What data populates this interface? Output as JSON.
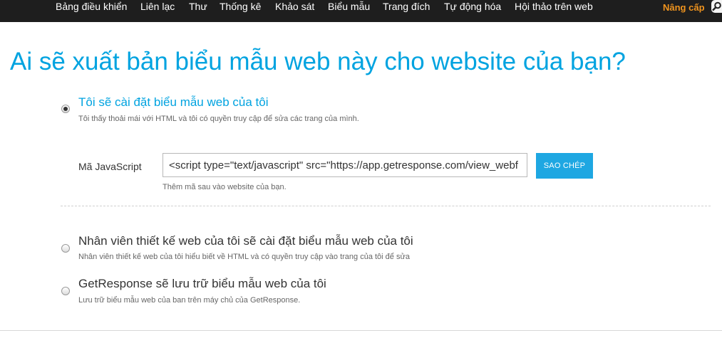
{
  "nav": {
    "items": [
      {
        "label": "Bảng điều khiển"
      },
      {
        "label": "Liên lạc"
      },
      {
        "label": "Thư"
      },
      {
        "label": "Thống kê"
      },
      {
        "label": "Khảo sát"
      },
      {
        "label": "Biểu mẫu"
      },
      {
        "label": "Trang đích"
      },
      {
        "label": "Tự động hóa"
      },
      {
        "label": "Hội thảo trên web"
      }
    ],
    "upgrade_label": "Nâng cấp"
  },
  "page": {
    "title": "Ai sẽ xuất bản biểu mẫu web này cho website của bạn?"
  },
  "options": [
    {
      "title": "Tôi sẽ cài đặt biểu mẫu web của tôi",
      "description": "Tôi thấy thoải mái với HTML và tôi có quyền truy cập để sửa các trang của mình.",
      "selected": true
    },
    {
      "title": "Nhân viên thiết kế web của tôi sẽ cài đặt biểu mẫu web của tôi",
      "description": "Nhân viên thiết kế web của tôi hiểu biết về HTML và có quyền truy cập vào trang của tôi để sửa",
      "selected": false
    },
    {
      "title": "GetResponse sẽ lưu trữ biểu mẫu web của tôi",
      "description": "Lưu trữ biểu mẫu web của ban trên máy chủ của GetResponse.",
      "selected": false
    }
  ],
  "javascript": {
    "label": "Mã JavaScript",
    "code_value": "<script type=\"text/javascript\" src=\"https://app.getresponse.com/view_webf",
    "copy_label": "SAO CHÉP",
    "hint": "Thêm mã sau vào website của bạn."
  },
  "colors": {
    "accent": "#00a3e0",
    "topbar": "#1e1e1e",
    "upgrade": "#f0941e",
    "button": "#1ea7e2"
  }
}
